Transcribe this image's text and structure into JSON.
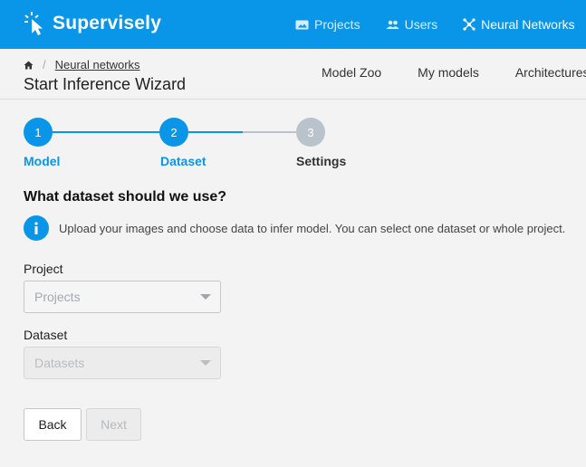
{
  "app": {
    "name": "Supervisely"
  },
  "colors": {
    "brand": "#0a96e8",
    "inactive_step": "#b9c3cc"
  },
  "topnav": {
    "items": [
      {
        "label": "Projects",
        "icon": "image-folder-icon"
      },
      {
        "label": "Users",
        "icon": "users-icon"
      },
      {
        "label": "Neural Networks",
        "icon": "neural-network-icon",
        "active": true
      }
    ]
  },
  "breadcrumb": {
    "home_icon": "home-icon",
    "separator": "/",
    "link": "Neural networks"
  },
  "page": {
    "title": "Start Inference Wizard"
  },
  "subnav": {
    "items": [
      "Model Zoo",
      "My models",
      "Architectures"
    ]
  },
  "stepper": {
    "steps": [
      {
        "number": "1",
        "label": "Model",
        "state": "done"
      },
      {
        "number": "2",
        "label": "Dataset",
        "state": "active"
      },
      {
        "number": "3",
        "label": "Settings",
        "state": "pending"
      }
    ]
  },
  "form": {
    "question": "What dataset should we use?",
    "info_icon": "info-icon",
    "info": "Upload your images and choose data to infer model. You can select one dataset or whole project.",
    "project_label": "Project",
    "project_placeholder": "Projects",
    "dataset_label": "Dataset",
    "dataset_placeholder": "Datasets"
  },
  "buttons": {
    "back": "Back",
    "next": "Next"
  }
}
